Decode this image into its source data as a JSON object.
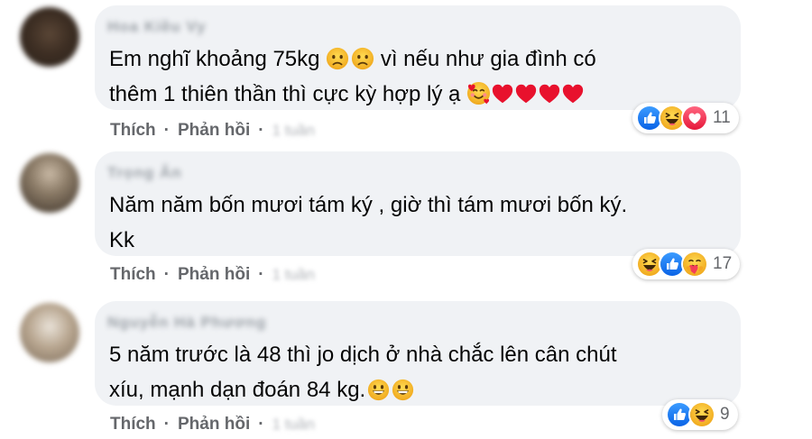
{
  "comments": [
    {
      "author": "Hoa Kiều Vy",
      "text_lines": [
        "Em nghĩ khoảng 75kg",
        "vì nếu như gia đình có",
        "thêm 1 thiên thần thì cực kỳ hợp lý ạ"
      ],
      "line1_emojis": [
        "worried-face",
        "worried-face"
      ],
      "line2_emojis": [
        "smiling-face-with-hearts",
        "red-heart",
        "red-heart",
        "red-heart",
        "red-heart"
      ],
      "reactions": [
        "like",
        "haha",
        "love"
      ],
      "reaction_count": "11",
      "like_label": "Thích",
      "reply_label": "Phản hồi",
      "time": "1 tuần"
    },
    {
      "author": "Trọng Ân",
      "text_lines": [
        "Năm năm bốn mươi tám ký , giờ thì tám mươi bốn ký.",
        "Kk"
      ],
      "reactions": [
        "haha",
        "like",
        "care"
      ],
      "reaction_count": "17",
      "like_label": "Thích",
      "reply_label": "Phản hồi",
      "time": "1 tuần"
    },
    {
      "author": "Nguyễn Hà Phương",
      "text_lines": [
        "5 năm trước là 48 thì jo dịch ở nhà chắc lên cân chút",
        "xíu, mạnh dạn đoán 84 kg."
      ],
      "line2_emojis": [
        "grinning-face",
        "grinning-face"
      ],
      "reactions": [
        "like",
        "haha"
      ],
      "reaction_count": "9",
      "like_label": "Thích",
      "reply_label": "Phản hồi",
      "time": "1 tuần"
    }
  ],
  "colors": {
    "bubble": "#f0f2f5",
    "text": "#050505",
    "secondary": "#65676b",
    "like_blue": "#1877f2",
    "love_red": "#f33e58",
    "haha_yellow": "#f7b125"
  }
}
